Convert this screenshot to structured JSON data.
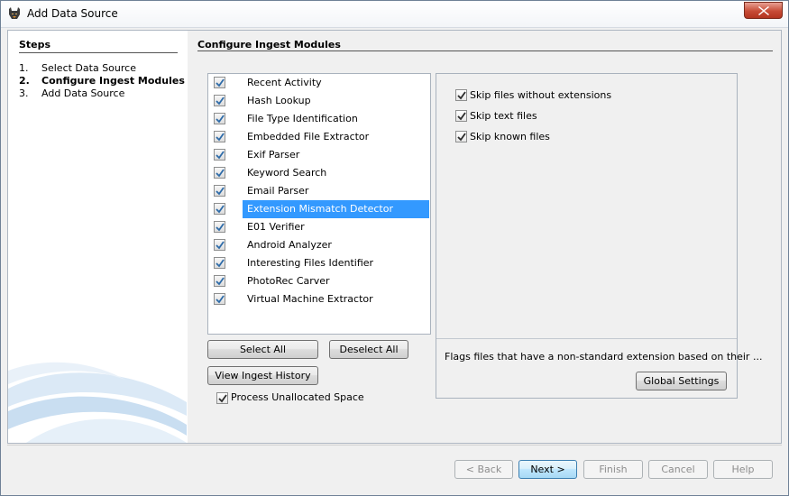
{
  "window": {
    "title": "Add Data Source"
  },
  "steps": {
    "title": "Steps",
    "items": [
      {
        "num": "1.",
        "label": "Select Data Source"
      },
      {
        "num": "2.",
        "label": "Configure Ingest Modules"
      },
      {
        "num": "3.",
        "label": "Add Data Source"
      }
    ],
    "current_index": 1
  },
  "main": {
    "title": "Configure Ingest Modules",
    "modules": [
      {
        "label": "Recent Activity",
        "checked": true
      },
      {
        "label": "Hash Lookup",
        "checked": true
      },
      {
        "label": "File Type Identification",
        "checked": true
      },
      {
        "label": "Embedded File Extractor",
        "checked": true
      },
      {
        "label": "Exif Parser",
        "checked": true
      },
      {
        "label": "Keyword Search",
        "checked": true
      },
      {
        "label": "Email Parser",
        "checked": true
      },
      {
        "label": "Extension Mismatch Detector",
        "checked": true,
        "selected": true
      },
      {
        "label": "E01 Verifier",
        "checked": true
      },
      {
        "label": "Android Analyzer",
        "checked": true
      },
      {
        "label": "Interesting Files Identifier",
        "checked": true
      },
      {
        "label": "PhotoRec Carver",
        "checked": true
      },
      {
        "label": "Virtual Machine Extractor",
        "checked": true
      }
    ],
    "select_all_label": "Select All",
    "deselect_all_label": "Deselect All",
    "view_history_label": "View Ingest History",
    "process_unallocated": {
      "label": "Process Unallocated Space",
      "checked": true
    }
  },
  "settings": {
    "options": [
      {
        "label": "Skip files without extensions",
        "checked": true
      },
      {
        "label": "Skip text files",
        "checked": true
      },
      {
        "label": "Skip known files",
        "checked": true
      }
    ],
    "description": "Flags files that have a non-standard extension based on their ...",
    "global_settings_label": "Global Settings"
  },
  "footer": {
    "back_label": "< Back",
    "next_label": "Next >",
    "finish_label": "Finish",
    "cancel_label": "Cancel",
    "help_label": "Help"
  },
  "colors": {
    "selection": "#3399ff",
    "close_button": "#c74b36"
  }
}
